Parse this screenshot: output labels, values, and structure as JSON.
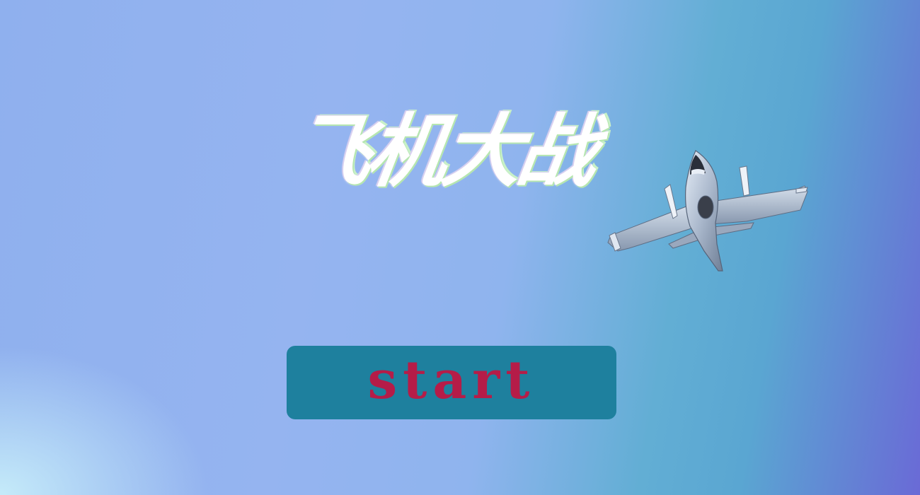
{
  "game": {
    "title_logo": "飞机大战",
    "start_label": "start"
  },
  "colors": {
    "button_bg": "#1e809e",
    "button_text": "#b51c48",
    "logo_fill": "#ffffff"
  },
  "icons": {
    "player_plane": "fighter-jet-icon"
  }
}
